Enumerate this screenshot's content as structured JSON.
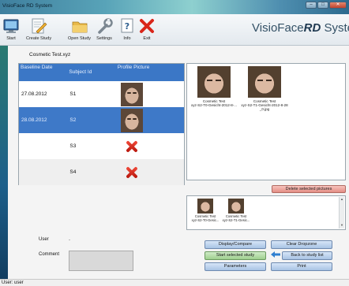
{
  "window": {
    "title": "VisioFace RD System",
    "minimize": "–",
    "maximize": "□",
    "close": "✕"
  },
  "toolbar": {
    "start": "Start",
    "create_study": "Create Study",
    "open_study": "Open Study",
    "settings": "Settings",
    "info": "Info",
    "exit": "Exit"
  },
  "brand": {
    "prefix": "VisioFace",
    "suffix": "RD",
    "tail": " Syste"
  },
  "study": {
    "title": "Cosmetic Test.xyz"
  },
  "grid": {
    "headers": {
      "date": "Baseline Date",
      "subject": "Subject Id",
      "picture": "Profile Picture"
    },
    "rows": [
      {
        "date": "27.08.2012",
        "subject": "S1",
        "picture": "photo"
      },
      {
        "date": "28.08.2012",
        "subject": "S2",
        "picture": "photo"
      },
      {
        "date": "",
        "subject": "S3",
        "picture": "missing"
      },
      {
        "date": "",
        "subject": "S4",
        "picture": "missing"
      }
    ]
  },
  "pictures": [
    {
      "caption1": "Cosmetic Test",
      "caption2": "xyz-S2-T0-Gesicht-2012-8-..."
    },
    {
      "caption1": "Cosmetic Test",
      "caption2": "xyz-S2-T1-Gesicht-2012-8-28",
      "caption3": "_0.jpg"
    }
  ],
  "selected": [
    {
      "caption1": "Cosmetic Test",
      "caption2": "xyz-S2-T0-Gesic..."
    },
    {
      "caption1": "Cosmetic Test",
      "caption2": "xyz-S2-T1-Gesic..."
    }
  ],
  "buttons": {
    "delete_selected": "Delete selected pictures",
    "display_compare": "Display/Compare",
    "clear_dropzone": "Clear Dropzone",
    "start_selected": "Start selected study",
    "back_to_list": "Back to study list",
    "parameters": "Parameters",
    "print": "Print"
  },
  "form": {
    "user_label": "User",
    "user_value": "-",
    "comment_label": "Comment"
  },
  "status": {
    "text": "User: user"
  },
  "colors": {
    "header_blue": "#3b77c6",
    "accent_red": "#d9261a",
    "brand": "#345166"
  }
}
